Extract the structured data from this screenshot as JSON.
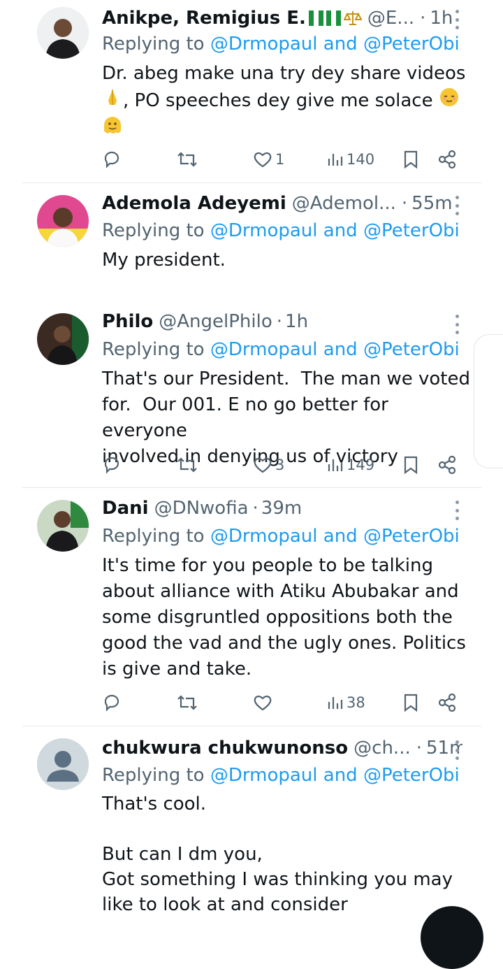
{
  "icons": {
    "reply": "speech-bubble-icon",
    "retweet": "retweet-icon",
    "like": "heart-icon",
    "views": "bar-chart-icon",
    "bookmark": "bookmark-icon",
    "share": "share-icon",
    "more": "more-vertical-icon"
  },
  "colors": {
    "link": "#1d9bf0",
    "muted": "#536471",
    "text": "#0f1419"
  },
  "tweets": [
    {
      "name": "Anikpe, Remigius E.",
      "handle": "@E...",
      "dot": "·",
      "time": "1h",
      "replying_prefix": "Replying to",
      "mention1": "@Drmopaul",
      "and": "and",
      "mention2": "@PeterObi",
      "text_line1": "Dr. abeg make una try dey share videos",
      "text_line2": ", PO speeches dey give me solace",
      "likes": "1",
      "views": "140"
    },
    {
      "name": "Ademola Adeyemi",
      "handle": "@Ademol...",
      "dot": "·",
      "time": "55m",
      "replying_prefix": "Replying to",
      "mention1": "@Drmopaul",
      "and": "and",
      "mention2": "@PeterObi",
      "text": "My president."
    },
    {
      "name": "Philo",
      "handle": "@AngelPhilo",
      "dot": "·",
      "time": "1h",
      "replying_prefix": "Replying to",
      "mention1": "@Drmopaul",
      "and": "and",
      "mention2": "@PeterObi",
      "text": "That's our President.  The man we voted\nfor.  Our 001. E no go better for  everyone\ninvolved in denying us of victory",
      "likes": "3",
      "views": "149"
    },
    {
      "name": "Dani",
      "handle": "@DNwofia",
      "dot": "·",
      "time": "39m",
      "replying_prefix": "Replying to",
      "mention1": "@Drmopaul",
      "and": "and",
      "mention2": "@PeterObi",
      "text": "It's time for you people to be talking\nabout alliance with Atiku Abubakar and\nsome disgruntled oppositions both the\ngood the vad and the ugly ones. Politics\nis give and take.",
      "views": "38"
    },
    {
      "name": "chukwura chukwunonso",
      "handle": "@ch...",
      "dot": "·",
      "time": "51m",
      "replying_prefix": "Replying to",
      "mention1": "@Drmopaul",
      "and": "and",
      "mention2": "@PeterObi",
      "text": "That's cool.\n\nBut can I dm you,\nGot something I was thinking you may\nlike to look at and consider"
    }
  ]
}
